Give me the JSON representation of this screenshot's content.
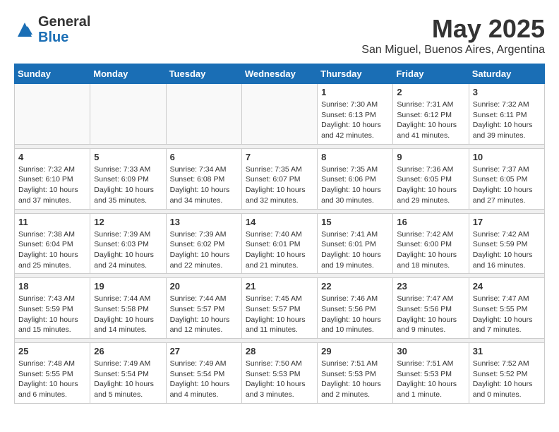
{
  "logo": {
    "general": "General",
    "blue": "Blue"
  },
  "title": "May 2025",
  "location": "San Miguel, Buenos Aires, Argentina",
  "weekdays": [
    "Sunday",
    "Monday",
    "Tuesday",
    "Wednesday",
    "Thursday",
    "Friday",
    "Saturday"
  ],
  "weeks": [
    [
      {
        "day": "",
        "info": ""
      },
      {
        "day": "",
        "info": ""
      },
      {
        "day": "",
        "info": ""
      },
      {
        "day": "",
        "info": ""
      },
      {
        "day": "1",
        "info": "Sunrise: 7:30 AM\nSunset: 6:13 PM\nDaylight: 10 hours\nand 42 minutes."
      },
      {
        "day": "2",
        "info": "Sunrise: 7:31 AM\nSunset: 6:12 PM\nDaylight: 10 hours\nand 41 minutes."
      },
      {
        "day": "3",
        "info": "Sunrise: 7:32 AM\nSunset: 6:11 PM\nDaylight: 10 hours\nand 39 minutes."
      }
    ],
    [
      {
        "day": "4",
        "info": "Sunrise: 7:32 AM\nSunset: 6:10 PM\nDaylight: 10 hours\nand 37 minutes."
      },
      {
        "day": "5",
        "info": "Sunrise: 7:33 AM\nSunset: 6:09 PM\nDaylight: 10 hours\nand 35 minutes."
      },
      {
        "day": "6",
        "info": "Sunrise: 7:34 AM\nSunset: 6:08 PM\nDaylight: 10 hours\nand 34 minutes."
      },
      {
        "day": "7",
        "info": "Sunrise: 7:35 AM\nSunset: 6:07 PM\nDaylight: 10 hours\nand 32 minutes."
      },
      {
        "day": "8",
        "info": "Sunrise: 7:35 AM\nSunset: 6:06 PM\nDaylight: 10 hours\nand 30 minutes."
      },
      {
        "day": "9",
        "info": "Sunrise: 7:36 AM\nSunset: 6:05 PM\nDaylight: 10 hours\nand 29 minutes."
      },
      {
        "day": "10",
        "info": "Sunrise: 7:37 AM\nSunset: 6:05 PM\nDaylight: 10 hours\nand 27 minutes."
      }
    ],
    [
      {
        "day": "11",
        "info": "Sunrise: 7:38 AM\nSunset: 6:04 PM\nDaylight: 10 hours\nand 25 minutes."
      },
      {
        "day": "12",
        "info": "Sunrise: 7:39 AM\nSunset: 6:03 PM\nDaylight: 10 hours\nand 24 minutes."
      },
      {
        "day": "13",
        "info": "Sunrise: 7:39 AM\nSunset: 6:02 PM\nDaylight: 10 hours\nand 22 minutes."
      },
      {
        "day": "14",
        "info": "Sunrise: 7:40 AM\nSunset: 6:01 PM\nDaylight: 10 hours\nand 21 minutes."
      },
      {
        "day": "15",
        "info": "Sunrise: 7:41 AM\nSunset: 6:01 PM\nDaylight: 10 hours\nand 19 minutes."
      },
      {
        "day": "16",
        "info": "Sunrise: 7:42 AM\nSunset: 6:00 PM\nDaylight: 10 hours\nand 18 minutes."
      },
      {
        "day": "17",
        "info": "Sunrise: 7:42 AM\nSunset: 5:59 PM\nDaylight: 10 hours\nand 16 minutes."
      }
    ],
    [
      {
        "day": "18",
        "info": "Sunrise: 7:43 AM\nSunset: 5:59 PM\nDaylight: 10 hours\nand 15 minutes."
      },
      {
        "day": "19",
        "info": "Sunrise: 7:44 AM\nSunset: 5:58 PM\nDaylight: 10 hours\nand 14 minutes."
      },
      {
        "day": "20",
        "info": "Sunrise: 7:44 AM\nSunset: 5:57 PM\nDaylight: 10 hours\nand 12 minutes."
      },
      {
        "day": "21",
        "info": "Sunrise: 7:45 AM\nSunset: 5:57 PM\nDaylight: 10 hours\nand 11 minutes."
      },
      {
        "day": "22",
        "info": "Sunrise: 7:46 AM\nSunset: 5:56 PM\nDaylight: 10 hours\nand 10 minutes."
      },
      {
        "day": "23",
        "info": "Sunrise: 7:47 AM\nSunset: 5:56 PM\nDaylight: 10 hours\nand 9 minutes."
      },
      {
        "day": "24",
        "info": "Sunrise: 7:47 AM\nSunset: 5:55 PM\nDaylight: 10 hours\nand 7 minutes."
      }
    ],
    [
      {
        "day": "25",
        "info": "Sunrise: 7:48 AM\nSunset: 5:55 PM\nDaylight: 10 hours\nand 6 minutes."
      },
      {
        "day": "26",
        "info": "Sunrise: 7:49 AM\nSunset: 5:54 PM\nDaylight: 10 hours\nand 5 minutes."
      },
      {
        "day": "27",
        "info": "Sunrise: 7:49 AM\nSunset: 5:54 PM\nDaylight: 10 hours\nand 4 minutes."
      },
      {
        "day": "28",
        "info": "Sunrise: 7:50 AM\nSunset: 5:53 PM\nDaylight: 10 hours\nand 3 minutes."
      },
      {
        "day": "29",
        "info": "Sunrise: 7:51 AM\nSunset: 5:53 PM\nDaylight: 10 hours\nand 2 minutes."
      },
      {
        "day": "30",
        "info": "Sunrise: 7:51 AM\nSunset: 5:53 PM\nDaylight: 10 hours\nand 1 minute."
      },
      {
        "day": "31",
        "info": "Sunrise: 7:52 AM\nSunset: 5:52 PM\nDaylight: 10 hours\nand 0 minutes."
      }
    ]
  ]
}
